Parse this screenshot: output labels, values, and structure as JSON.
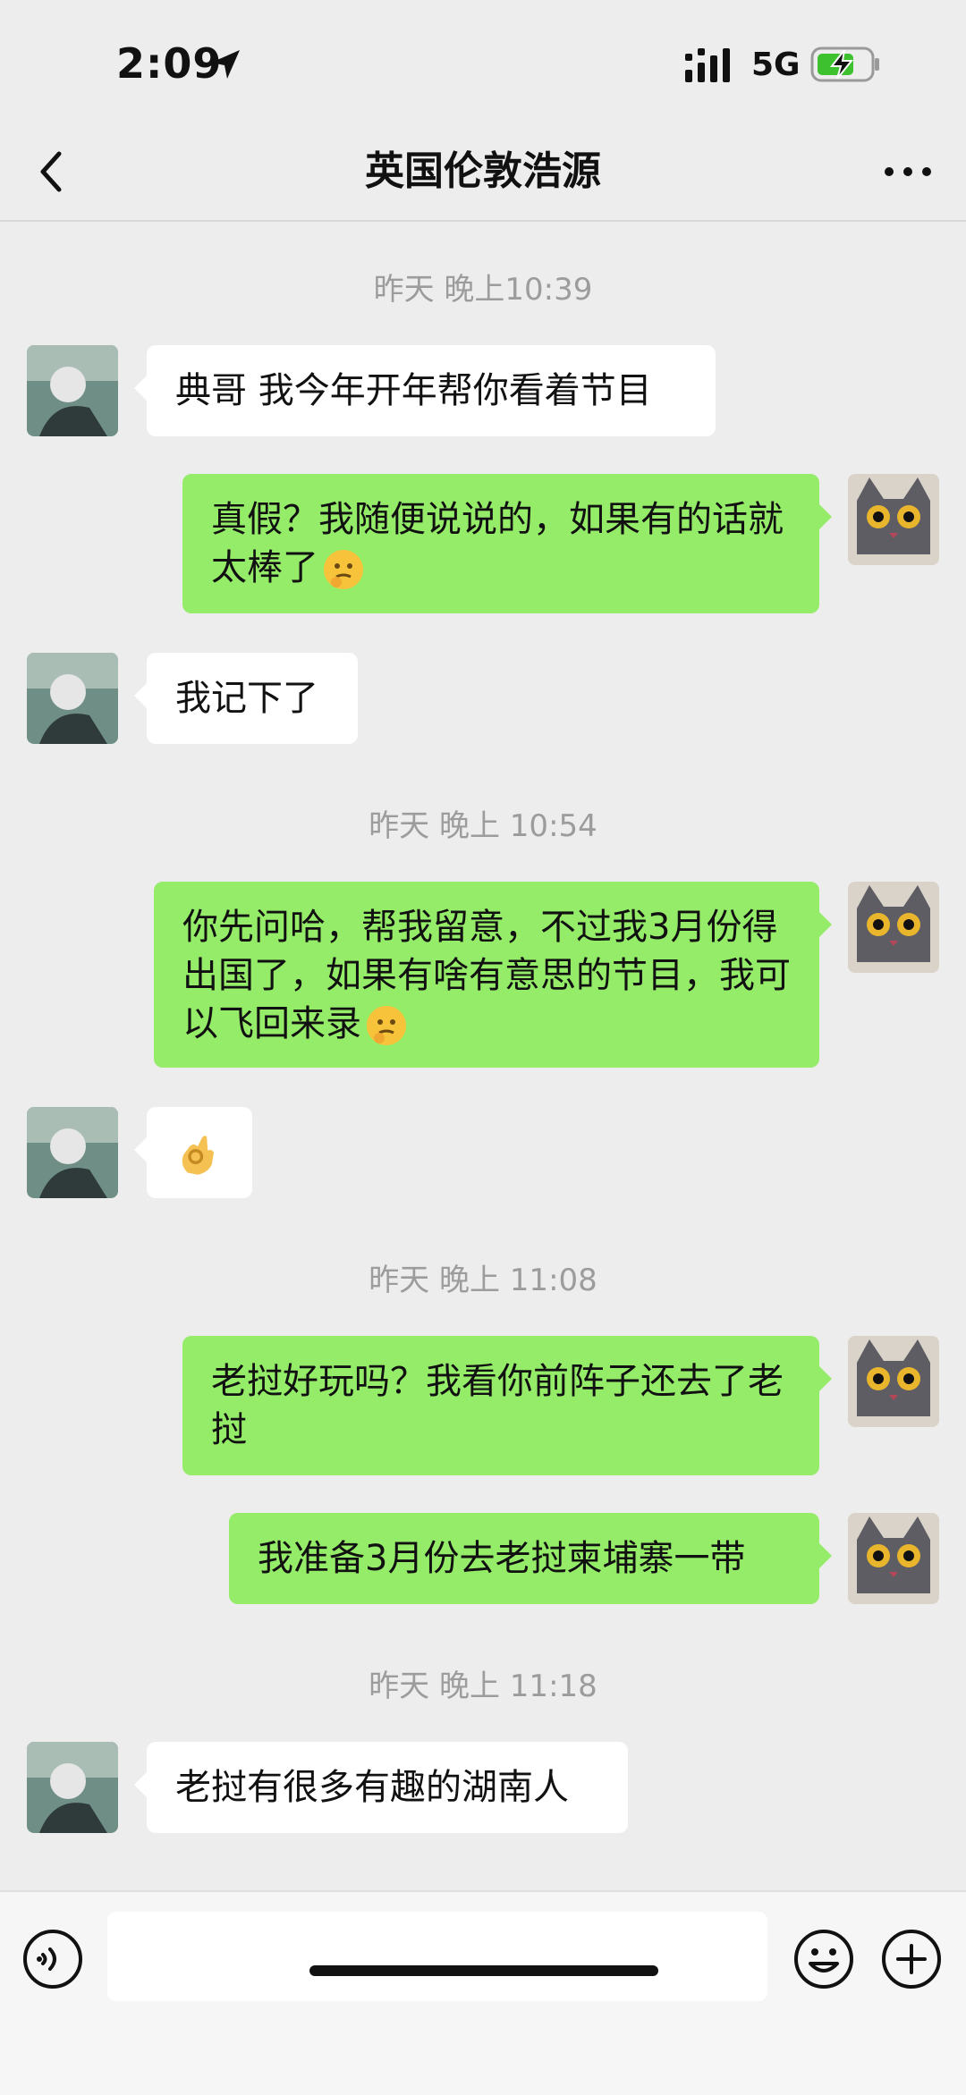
{
  "status_bar": {
    "time": "2:09",
    "network": "5G"
  },
  "header": {
    "title": "英国伦敦浩源"
  },
  "timestamps": [
    "昨天 晚上10:39",
    "昨天 晚上 10:54",
    "昨天 晚上 11:08",
    "昨天 晚上 11:18"
  ],
  "messages": [
    {
      "from": "other",
      "text": "典哥 我今年开年帮你看着节目"
    },
    {
      "from": "me",
      "text": "真假？我随便说说的，如果有的话就太棒了",
      "emoji": "thinking-face"
    },
    {
      "from": "other",
      "text": "我记下了"
    },
    {
      "from": "me",
      "text": "你先问哈，帮我留意，不过我3月份得出国了，如果有啥有意思的节目，我可以飞回来录",
      "emoji": "thinking-face"
    },
    {
      "from": "other",
      "text": "",
      "emoji": "ok-hand"
    },
    {
      "from": "me",
      "text": "老挝好玩吗？我看你前阵子还去了老挝"
    },
    {
      "from": "me",
      "text": "我准备3月份去老挝柬埔寨一带"
    },
    {
      "from": "other",
      "text": "老挝有很多有趣的湖南人"
    }
  ],
  "colors": {
    "background": "#ededed",
    "outgoing_bubble": "#95ec69",
    "incoming_bubble": "#ffffff",
    "timestamp": "#9c9c9c"
  },
  "icons": {
    "back": "chevron-left-icon",
    "more": "more-dots-icon",
    "voice": "voice-icon",
    "emoji": "smiley-icon",
    "plus": "plus-icon"
  }
}
